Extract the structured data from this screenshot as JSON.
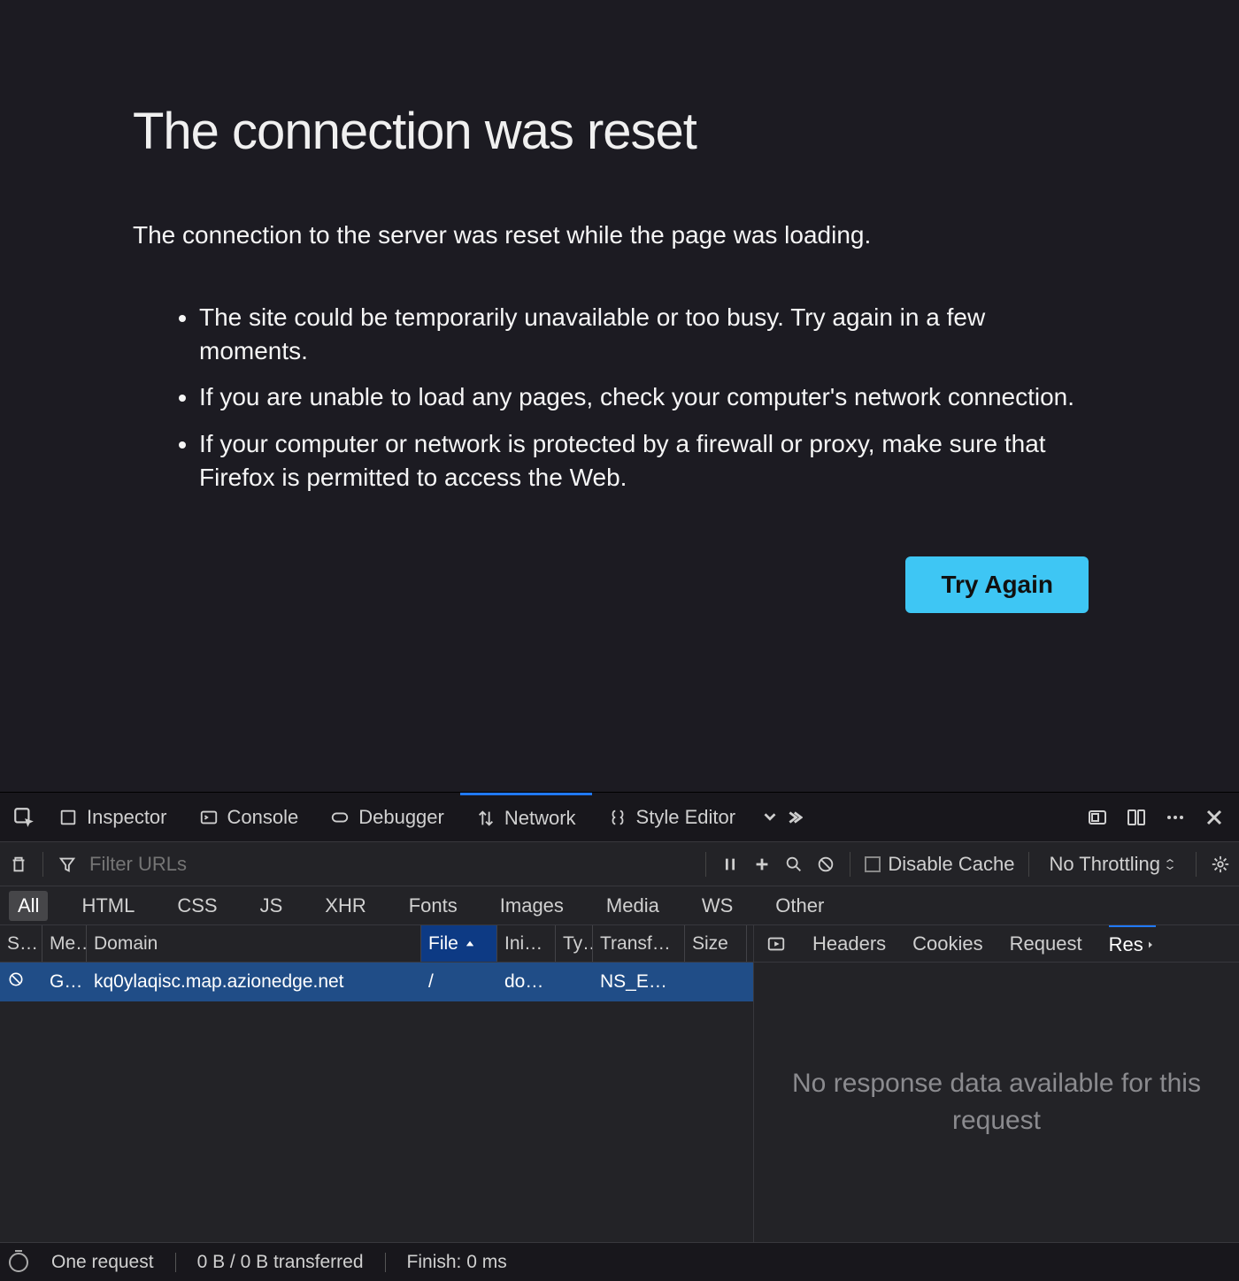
{
  "error": {
    "title": "The connection was reset",
    "description": "The connection to the server was reset while the page was loading.",
    "bullets": [
      "The site could be temporarily unavailable or too busy. Try again in a few moments.",
      "If you are unable to load any pages, check your computer's network connection.",
      "If your computer or network is protected by a firewall or proxy, make sure that Firefox is permitted to access the Web."
    ],
    "try_again": "Try Again"
  },
  "devtools": {
    "tabs": {
      "inspector": "Inspector",
      "console": "Console",
      "debugger": "Debugger",
      "network": "Network",
      "style_editor": "Style Editor"
    },
    "toolbar": {
      "filter_placeholder": "Filter URLs",
      "disable_cache": "Disable Cache",
      "throttling": "No Throttling"
    },
    "filters": {
      "all": "All",
      "html": "HTML",
      "css": "CSS",
      "js": "JS",
      "xhr": "XHR",
      "fonts": "Fonts",
      "images": "Images",
      "media": "Media",
      "ws": "WS",
      "other": "Other"
    },
    "columns": {
      "status": "S…",
      "method": "Me…",
      "domain": "Domain",
      "file": "File",
      "initiator": "Ini…",
      "type": "Ty…",
      "transferred": "Transf…",
      "size": "Size"
    },
    "request": {
      "method": "GET",
      "domain": "kq0ylaqisc.map.azionedge.net",
      "file": "/",
      "initiator": "do…",
      "transferred": "NS_E…"
    },
    "detail_tabs": {
      "headers": "Headers",
      "cookies": "Cookies",
      "request": "Request",
      "response": "Res"
    },
    "detail_body": "No response data available for this request",
    "status": {
      "requests": "One request",
      "transferred": "0 B / 0 B transferred",
      "finish": "Finish: 0 ms"
    }
  }
}
